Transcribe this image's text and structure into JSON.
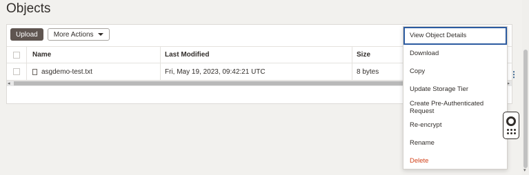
{
  "page": {
    "title": "Objects"
  },
  "toolbar": {
    "upload_label": "Upload",
    "more_actions_label": "More Actions"
  },
  "table": {
    "columns": [
      "Name",
      "Last Modified",
      "Size"
    ],
    "rows": [
      {
        "name": "asgdemo-test.txt",
        "last_modified": "Fri, May 19, 2023, 09:42:21 UTC",
        "size": "8 bytes"
      }
    ]
  },
  "menu": {
    "items": [
      "View Object Details",
      "Download",
      "Copy",
      "Update Storage Tier",
      "Create Pre-Authenticated Request",
      "Re-encrypt",
      "Rename",
      "Delete"
    ],
    "focused_index": 0,
    "danger_index": 7
  },
  "icons": {
    "file": "file-icon",
    "kebab": "kebab-menu-icon",
    "help": "lifebuoy-icon",
    "apps": "grid-dots-icon"
  },
  "colors": {
    "primary_button": "#5f5550",
    "danger": "#d2421a",
    "focus": "#2b5aa0"
  }
}
